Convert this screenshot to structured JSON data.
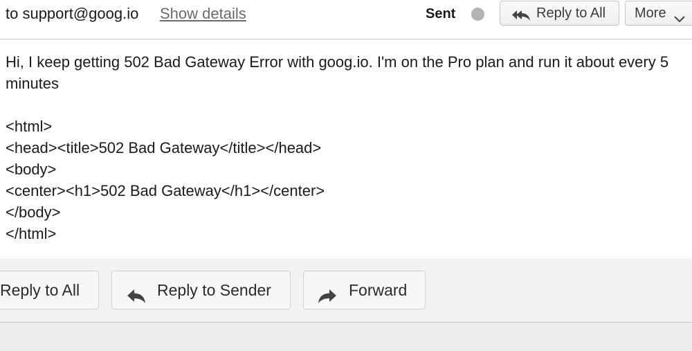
{
  "header": {
    "recipient": "to support@goog.io",
    "show_details": "Show details",
    "status_label": "Sent",
    "reply_all_label": "Reply to All",
    "more_label": "More"
  },
  "message": {
    "intro": "Hi, I keep getting 502 Bad Gateway Error with goog.io. I'm on the Pro plan and run it about every 5 minutes",
    "code_lines": [
      "<html>",
      "<head><title>502 Bad Gateway</title></head>",
      "<body>",
      "<center><h1>502 Bad Gateway</h1></center>",
      "</body>",
      "</html>"
    ]
  },
  "footer": {
    "reply_all_label": "Reply to All",
    "reply_sender_label": "Reply to Sender",
    "forward_label": "Forward"
  },
  "icons": {
    "reply_all": "reply-all-icon",
    "reply": "reply-icon",
    "forward": "forward-icon",
    "chevron": "chevron-down-icon"
  },
  "colors": {
    "status_dot": "#b3b3b3",
    "link": "#6b6b6b",
    "footer_bg": "#f2f2f2"
  }
}
